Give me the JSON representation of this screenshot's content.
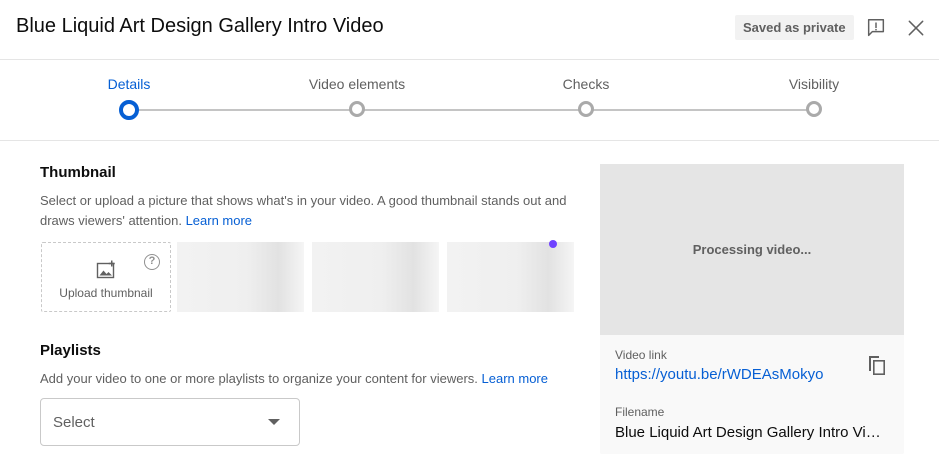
{
  "header": {
    "title": "Blue Liquid Art Design Gallery Intro Video",
    "saved_badge": "Saved as private",
    "feedback_icon": "report-feedback-icon",
    "close_icon": "close-icon"
  },
  "stepper": {
    "steps": [
      {
        "label": "Details",
        "active": true
      },
      {
        "label": "Video elements",
        "active": false
      },
      {
        "label": "Checks",
        "active": false
      },
      {
        "label": "Visibility",
        "active": false
      }
    ],
    "active_color": "#065fd4",
    "inactive_color": "#aaaaaa"
  },
  "thumbnail": {
    "title": "Thumbnail",
    "description": "Select or upload a picture that shows what's in your video. A good thumbnail stands out and draws viewers' attention.",
    "learn_more": "Learn more",
    "upload_label": "Upload thumbnail",
    "help_glyph": "?"
  },
  "playlists": {
    "title": "Playlists",
    "description": "Add your video to one or more playlists to organize your content for viewers.",
    "learn_more": "Learn more",
    "select_label": "Select"
  },
  "preview": {
    "status": "Processing video...",
    "video_link_label": "Video link",
    "video_link": "https://youtu.be/rWDEAsMokyo",
    "filename_label": "Filename",
    "filename": "Blue Liquid Art Design Gallery Intro Video"
  }
}
